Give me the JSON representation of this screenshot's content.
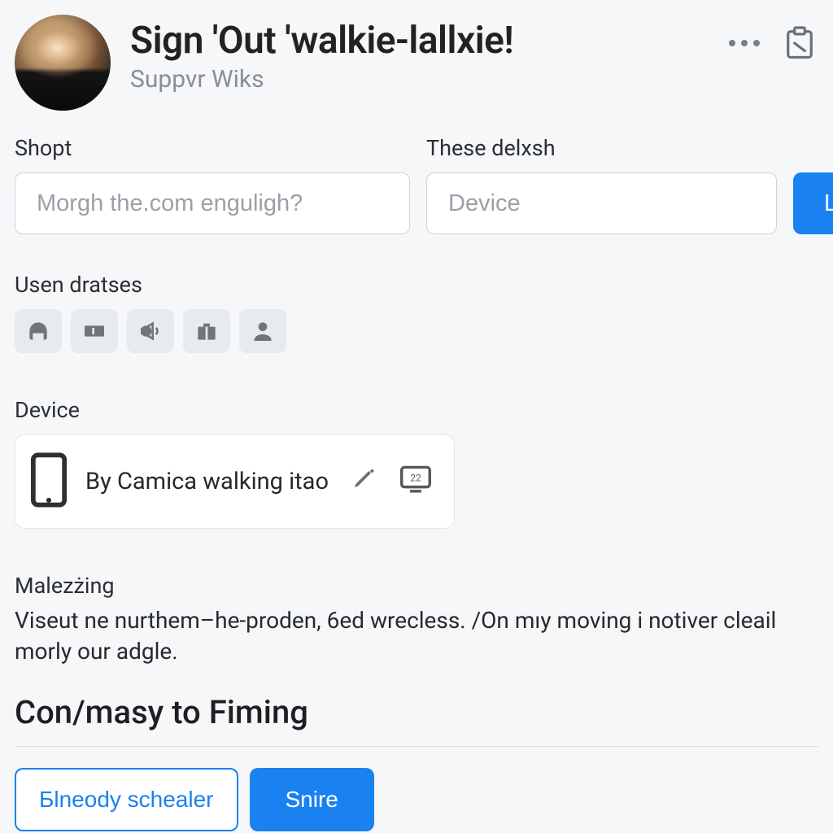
{
  "header": {
    "title": "Sign 'Out 'walkie-lallxie!",
    "subtitle": "Suppvr Wiks"
  },
  "fields": {
    "shopt": {
      "label": "Shopt",
      "placeholder": "Morgh the.com enguligh?"
    },
    "delxsh": {
      "label": "These delxsh",
      "placeholder": "Device"
    },
    "logo_button": "Logo"
  },
  "usen": {
    "label": "Usen dratses",
    "icons": [
      "headphones",
      "ticket",
      "announce",
      "briefcase",
      "person"
    ]
  },
  "device": {
    "label": "Device",
    "text": "By Camica walking itao"
  },
  "paragraph": {
    "title": "Malezżing",
    "body": "Viseut ne nurthem–he-proden, 6ed wrecless. /On mıy moving i notiver cleail morly our adgle."
  },
  "section_heading": "Con/masy to Fiming",
  "buttons": {
    "secondary": "Бlneody schealer",
    "primary": "Snire"
  }
}
